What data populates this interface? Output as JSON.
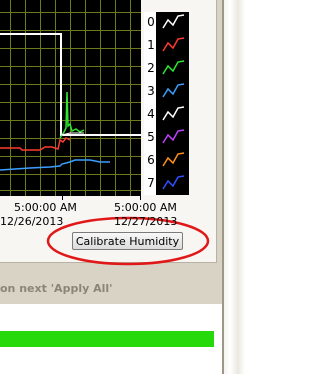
{
  "chart": {
    "x_ticks": [
      {
        "time": "5:00:00 AM",
        "date": "12/26/2013"
      },
      {
        "time": "5:00:00 AM",
        "date": "12/27/2013"
      }
    ],
    "background": "#000000",
    "grid_color": "#6f7a1e",
    "series": [
      {
        "legend_num": "0",
        "color": "#ffffff"
      },
      {
        "legend_num": "1",
        "color": "#ff3b30"
      },
      {
        "legend_num": "2",
        "color": "#2ee62e"
      },
      {
        "legend_num": "3",
        "color": "#3aa0ff"
      },
      {
        "legend_num": "4",
        "color": "#ffffff"
      },
      {
        "legend_num": "5",
        "color": "#c040ff"
      },
      {
        "legend_num": "6",
        "color": "#ff9020"
      },
      {
        "legend_num": "7",
        "color": "#3050ff"
      }
    ]
  },
  "calibrate_button": {
    "label": "Calibrate Humidity"
  },
  "annotation_color": "#e01818",
  "hint_text": "on next 'Apply All'",
  "progress": {
    "fraction": 1.0,
    "color": "#25d90a"
  }
}
